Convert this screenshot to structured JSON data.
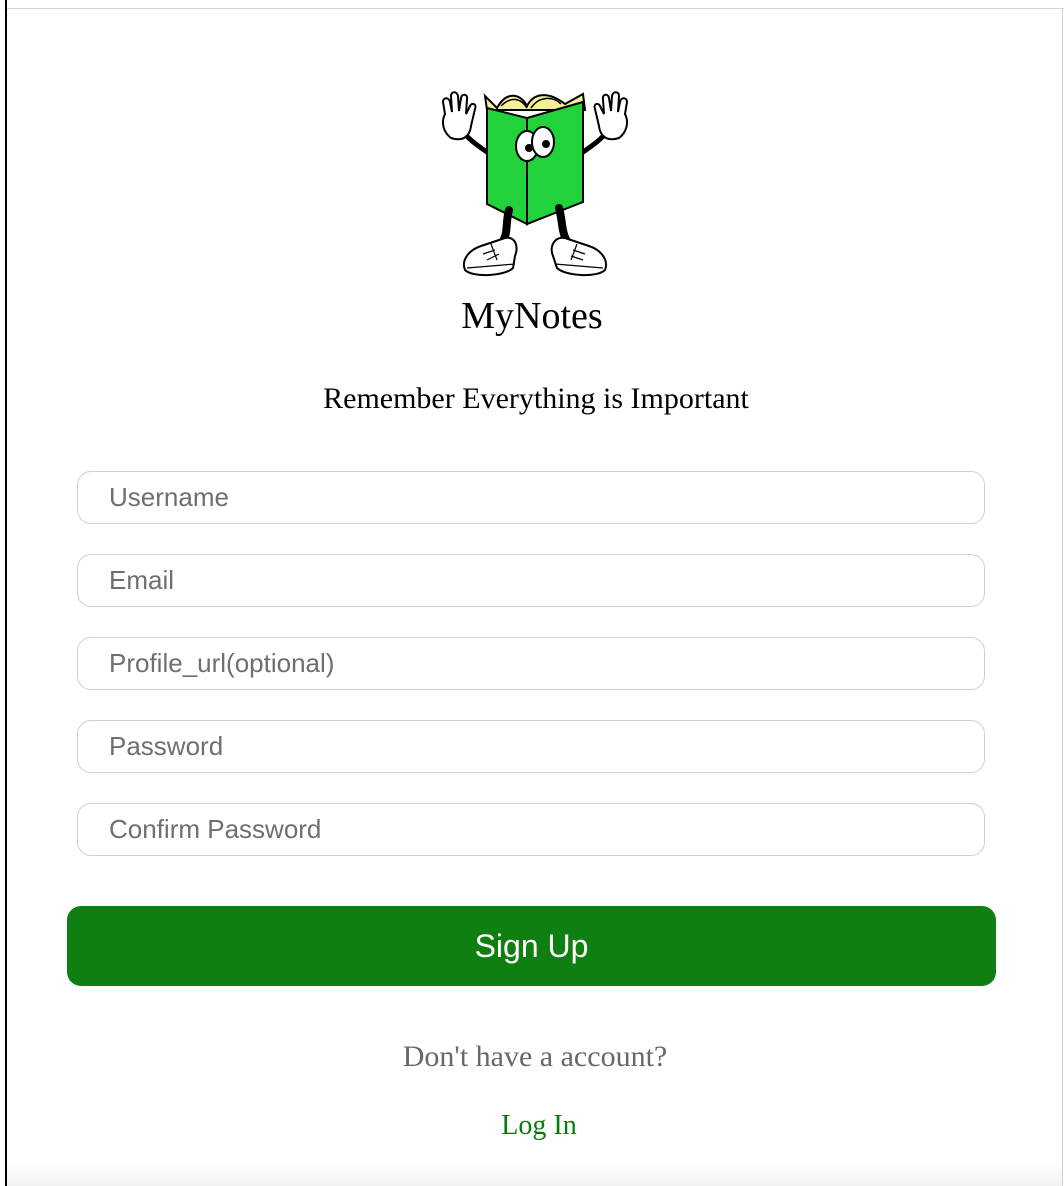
{
  "app": {
    "title": "MyNotes",
    "tagline": "Remember Everything is Important"
  },
  "mascot": {
    "icon": "book-mascot-icon",
    "colors": {
      "book": "#22d23a",
      "pages": "#f4ef9a"
    }
  },
  "form": {
    "username": {
      "placeholder": "Username",
      "value": ""
    },
    "email": {
      "placeholder": "Email",
      "value": ""
    },
    "profile_url": {
      "placeholder": "Profile_url(optional)",
      "value": ""
    },
    "password": {
      "placeholder": "Password",
      "value": ""
    },
    "confirm_password": {
      "placeholder": "Confirm Password",
      "value": ""
    },
    "submit_label": "Sign Up"
  },
  "footer": {
    "prompt": "Don't have a account?",
    "login_label": "Log In"
  },
  "colors": {
    "primary": "#107f12",
    "link": "#0a7a0c",
    "muted_text": "#686868",
    "field_border": "#cfcfcf"
  }
}
